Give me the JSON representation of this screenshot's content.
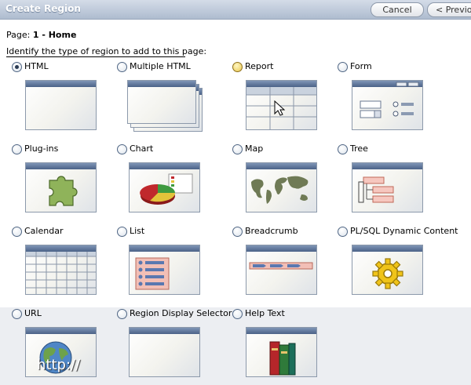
{
  "header": {
    "title": "Create Region",
    "cancel_label": "Cancel",
    "previous_label": "< Previous"
  },
  "page": {
    "label": "Page:",
    "value": "1 - Home"
  },
  "instruction": "Identify the type of region to add to this page:",
  "region_types": [
    {
      "label": "HTML",
      "selected": true,
      "icon": "html-region-icon"
    },
    {
      "label": "Multiple HTML",
      "selected": false,
      "icon": "multiple-html-icon"
    },
    {
      "label": "Report",
      "selected": false,
      "icon": "report-grid-icon"
    },
    {
      "label": "Form",
      "selected": false,
      "icon": "form-icon"
    },
    {
      "label": "Plug-ins",
      "selected": false,
      "icon": "puzzle-piece-icon"
    },
    {
      "label": "Chart",
      "selected": false,
      "icon": "pie-chart-icon"
    },
    {
      "label": "Map",
      "selected": false,
      "icon": "world-map-icon"
    },
    {
      "label": "Tree",
      "selected": false,
      "icon": "tree-icon"
    },
    {
      "label": "Calendar",
      "selected": false,
      "icon": "calendar-icon"
    },
    {
      "label": "List",
      "selected": false,
      "icon": "list-icon"
    },
    {
      "label": "Breadcrumb",
      "selected": false,
      "icon": "breadcrumb-icon"
    },
    {
      "label": "PL/SQL Dynamic Content",
      "selected": false,
      "icon": "gear-icon"
    },
    {
      "label": "URL",
      "selected": false,
      "icon": "globe-icon",
      "caption": "http://"
    },
    {
      "label": "Region Display Selector",
      "selected": false,
      "icon": "region-display-selector-icon"
    },
    {
      "label": "Help Text",
      "selected": false,
      "icon": "books-icon"
    }
  ],
  "colors": {
    "header_bar": "#aebccf",
    "thumb_header": "#4b6288",
    "band": "#eceef2"
  }
}
